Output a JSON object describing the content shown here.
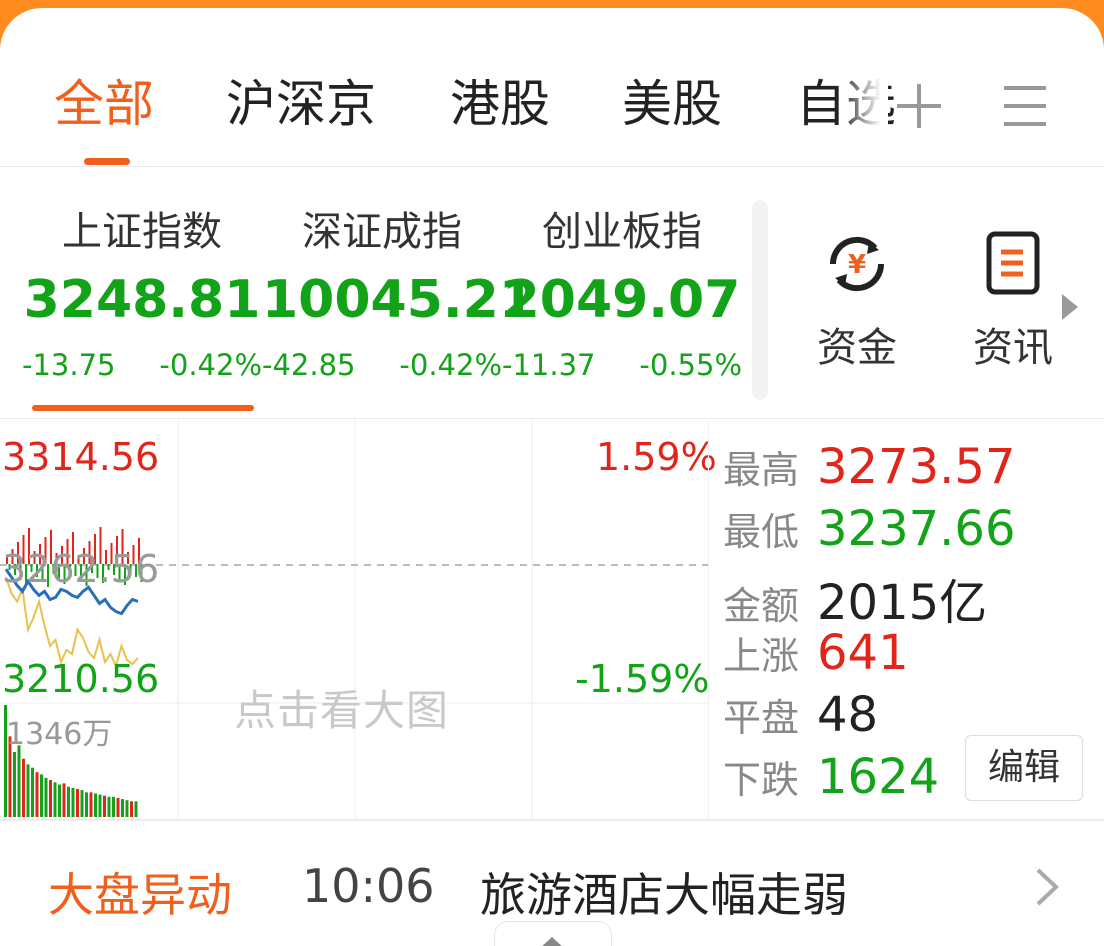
{
  "tabs": {
    "items": [
      "全部",
      "沪深京",
      "港股",
      "美股",
      "自选"
    ],
    "active_index": 0,
    "add_icon": "plus-icon",
    "menu_icon": "menu-icon"
  },
  "indices": [
    {
      "name": "上证指数",
      "value": "3248.81",
      "change": "-13.75",
      "pct": "-0.42%"
    },
    {
      "name": "深证成指",
      "value": "10045.21",
      "change": "-42.85",
      "pct": "-0.42%"
    },
    {
      "name": "创业板指",
      "value": "2049.07",
      "change": "-11.37",
      "pct": "-0.55%"
    }
  ],
  "quick": [
    {
      "label": "资金",
      "icon": "yuan-flow-icon"
    },
    {
      "label": "资讯",
      "icon": "document-icon"
    }
  ],
  "chart": {
    "top_price": "3314.56",
    "mid_price": "3262.56",
    "bottom_price": "3210.56",
    "top_pct": "1.59%",
    "bottom_pct": "-1.59%",
    "volume_label": "1346万",
    "watermark": "点击看大图",
    "colors": {
      "up": "#e1251b",
      "down": "#12a318",
      "index_line": "#2a6fb8",
      "avg_line": "#e8c24a"
    }
  },
  "chart_data": {
    "type": "line",
    "title": "",
    "ylim": [
      3210.56,
      3314.56
    ],
    "reference": 3262.56,
    "series": [
      {
        "values": [
          3260,
          3256,
          3252,
          3249,
          3254,
          3250,
          3247,
          3249,
          3245,
          3246,
          3250,
          3249,
          3247,
          3246,
          3249,
          3251,
          3247,
          3243,
          3245,
          3241,
          3239,
          3238,
          3242,
          3245,
          3244
        ]
      },
      {
        "values": [
          3256,
          3248,
          3244,
          3250,
          3230,
          3236,
          3244,
          3232,
          3222,
          3225,
          3214,
          3220,
          3218,
          3230,
          3226,
          3219,
          3216,
          3225,
          3214,
          3218,
          3212,
          3222,
          3215,
          3213,
          3216
        ]
      }
    ],
    "volume": [
      100,
      72,
      58,
      64,
      52,
      47,
      44,
      40,
      38,
      35,
      33,
      31,
      29,
      30,
      27,
      26,
      25,
      24,
      22,
      22,
      21,
      20,
      19,
      18,
      18,
      17,
      16,
      15,
      14,
      14
    ]
  },
  "stats": [
    {
      "label": "最高",
      "value": "3273.57",
      "tone": "up"
    },
    {
      "label": "最低",
      "value": "3237.66",
      "tone": "down"
    },
    {
      "label": "金额",
      "value": "2015亿",
      "tone": "flat"
    },
    {
      "label": "上涨",
      "value": "641",
      "tone": "up"
    },
    {
      "label": "平盘",
      "value": "48",
      "tone": "flat"
    },
    {
      "label": "下跌",
      "value": "1624",
      "tone": "down"
    }
  ],
  "edit_label": "编辑",
  "news": {
    "title": "大盘异动",
    "time": "10:06",
    "headline": "旅游酒店大幅走弱"
  }
}
